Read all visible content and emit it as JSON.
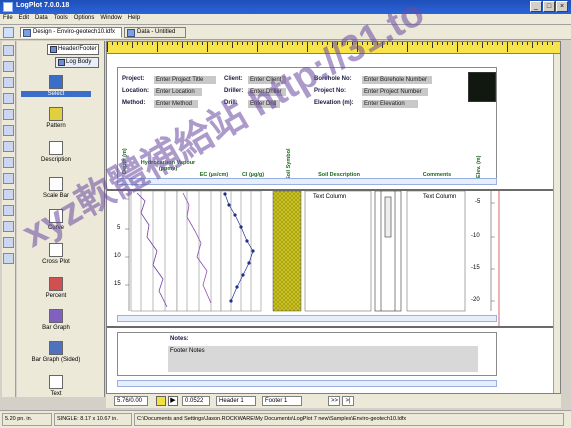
{
  "app": {
    "title": "LogPlot 7.0.0.18"
  },
  "menu": [
    "File",
    "Edit",
    "Data",
    "Tools",
    "Options",
    "Window",
    "Help"
  ],
  "tabs": [
    {
      "label": "Design - Enviro-geotech10.ldfx",
      "active": true
    },
    {
      "label": "Data - Untitled",
      "active": false
    }
  ],
  "palette": {
    "nav": [
      "Header/Footer",
      "Log Body"
    ],
    "items": [
      "Select",
      "Pattern",
      "Description",
      "Scale Bar",
      "Curve",
      "Cross Plot",
      "Percent",
      "Bar Graph",
      "Bar Graph (Sided)",
      "Text"
    ]
  },
  "header": {
    "labels": {
      "project": "Project:",
      "location": "Location:",
      "method": "Method:",
      "client": "Client:",
      "driller": "Driller:",
      "drill": "Drill:",
      "borehole": "Borehole No:",
      "project_no": "Project No:",
      "elevation": "Elevation (m):"
    },
    "values": {
      "project": "Enter Project Title",
      "location": "Enter Location",
      "method": "Enter Method",
      "client": "Enter Client",
      "driller": "Enter Driller",
      "drill": "Enter Drill",
      "borehole": "Enter Borehole Number",
      "project_no": "Enter Project Number",
      "elevation": "Enter Elevation"
    },
    "columns": {
      "depth": "Depth (m)",
      "hydrocarbon": "Hydrocarbon Vapour (ppmv)",
      "ec": "EC (µs/cm)",
      "cl": "Cl (µg/g)",
      "soil_symbol": "Soil Symbol",
      "soil_desc": "Soil Description",
      "comments": "Comments",
      "elev": "Elev. (m)"
    }
  },
  "body": {
    "depth_ticks": [
      "5",
      "10",
      "15"
    ],
    "right_ticks": [
      "-5",
      "-10",
      "-15",
      "-20"
    ],
    "text_columns": [
      "Text Column",
      "Text Column"
    ]
  },
  "footer": {
    "notes_label": "Notes:",
    "footer_notes_value": "Footer Notes"
  },
  "nav": {
    "position": "5.76/0.00",
    "scale": "0.0522",
    "header_select": "Header 1",
    "footer_select": "Footer 1",
    "next": ">>",
    "last": ">|"
  },
  "status": {
    "cursor": "5.20 pn. in.",
    "page_size": "SINGLE: 8.17 x 10.67 in.",
    "path": "C:\\Documents and Settings\\Jason.ROCKWARE\\My Documents\\LogPlot 7 new\\Samples\\Enviro-geotech10.ldfx"
  },
  "watermark": {
    "text": "xyz軟體補給站 http://31.to"
  },
  "colors": {
    "accent": "#2a64d8",
    "ruler": "#f7e34a",
    "soil_pattern": "#c8c020"
  }
}
